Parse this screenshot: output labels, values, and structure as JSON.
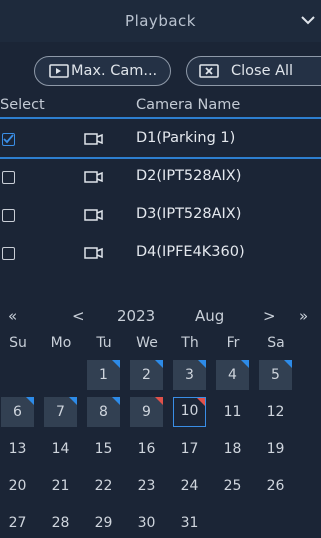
{
  "header": {
    "title": "Playback",
    "chevron_icon": "chevron-down-icon"
  },
  "buttons": {
    "max": "Max. Cam...",
    "close_all": "Close All"
  },
  "table": {
    "col_select": "Select",
    "col_name": "Camera Name",
    "rows": [
      {
        "name": "D1(Parking 1)",
        "checked": true
      },
      {
        "name": "D2(IPT528AIX)",
        "checked": false
      },
      {
        "name": "D3(IPT528AIX)",
        "checked": false
      },
      {
        "name": "D4(IPFE4K360)",
        "checked": false
      }
    ]
  },
  "calendar": {
    "prev_year": "«",
    "prev_month": "<",
    "year": "2023",
    "month": "Aug",
    "next_month": ">",
    "next_year": "»",
    "weekdays": [
      "Su",
      "Mo",
      "Tu",
      "We",
      "Th",
      "Fr",
      "Sa"
    ],
    "days": [
      {
        "d": "1",
        "rec": true,
        "mark": "blue"
      },
      {
        "d": "2",
        "rec": true,
        "mark": "blue"
      },
      {
        "d": "3",
        "rec": true,
        "mark": "blue"
      },
      {
        "d": "4",
        "rec": true,
        "mark": "blue"
      },
      {
        "d": "5",
        "rec": true,
        "mark": "blue"
      },
      {
        "d": "6",
        "rec": true,
        "mark": "blue"
      },
      {
        "d": "7",
        "rec": true,
        "mark": "blue"
      },
      {
        "d": "8",
        "rec": true,
        "mark": "blue"
      },
      {
        "d": "9",
        "rec": true,
        "mark": "red"
      },
      {
        "d": "10",
        "rec": false,
        "mark": "red",
        "today": true
      },
      {
        "d": "11"
      },
      {
        "d": "12"
      },
      {
        "d": "13"
      },
      {
        "d": "14"
      },
      {
        "d": "15"
      },
      {
        "d": "16"
      },
      {
        "d": "17"
      },
      {
        "d": "18"
      },
      {
        "d": "19"
      },
      {
        "d": "20"
      },
      {
        "d": "21"
      },
      {
        "d": "22"
      },
      {
        "d": "23"
      },
      {
        "d": "24"
      },
      {
        "d": "25"
      },
      {
        "d": "26"
      },
      {
        "d": "27"
      },
      {
        "d": "28"
      },
      {
        "d": "29"
      },
      {
        "d": "30"
      },
      {
        "d": "31"
      }
    ],
    "first_weekday_index": 2
  },
  "colors": {
    "accent": "#2d7fd0",
    "record_bg": "#324052",
    "mark_blue": "#2d8be8",
    "mark_red": "#e0514a"
  }
}
